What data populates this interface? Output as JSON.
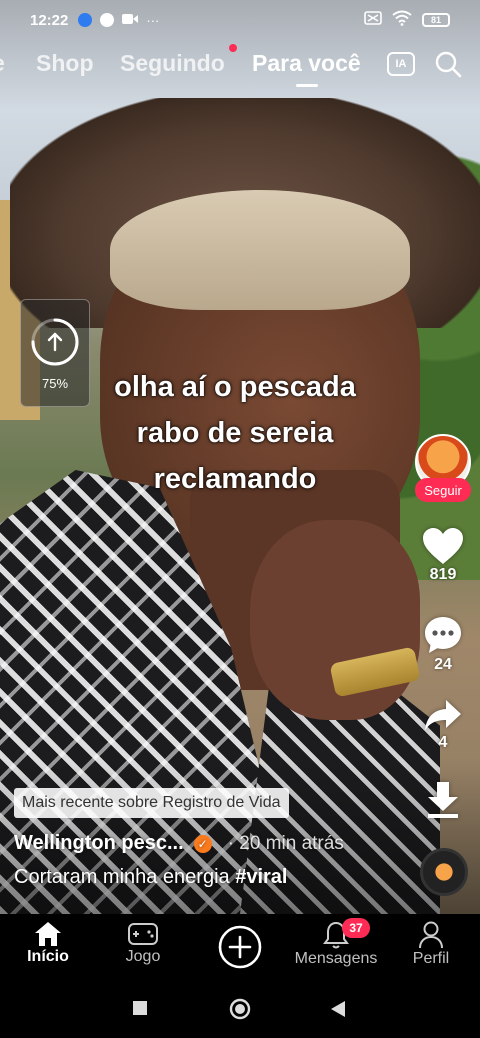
{
  "status_bar": {
    "time": "12:22",
    "extra_icons": "···",
    "battery": "81"
  },
  "top_tabs": {
    "edge_fragment": "e",
    "shop": "Shop",
    "following": "Seguindo",
    "for_you": "Para você",
    "ia_label": "IA"
  },
  "upload": {
    "progress_percent": 75,
    "label": "75%"
  },
  "caption": {
    "line1": "olha aí o pescada",
    "line2": "rabo de sereia",
    "line3": "reclamando"
  },
  "rail": {
    "follow_label": "Seguir",
    "likes": "819",
    "comments": "24",
    "shares": "4"
  },
  "video_info": {
    "related": "Mais recente sobre Registro de Vida",
    "author": "Wellington pesc...",
    "time_ago": "· 20 min atrás",
    "description": "Cortaram minha energia ",
    "hashtag": "#viral"
  },
  "bottom_nav": {
    "home": "Início",
    "game": "Jogo",
    "messages": "Mensagens",
    "messages_badge": "37",
    "profile": "Perfil"
  },
  "colors": {
    "accent": "#fe2c55",
    "verified": "#fa7a1e"
  }
}
